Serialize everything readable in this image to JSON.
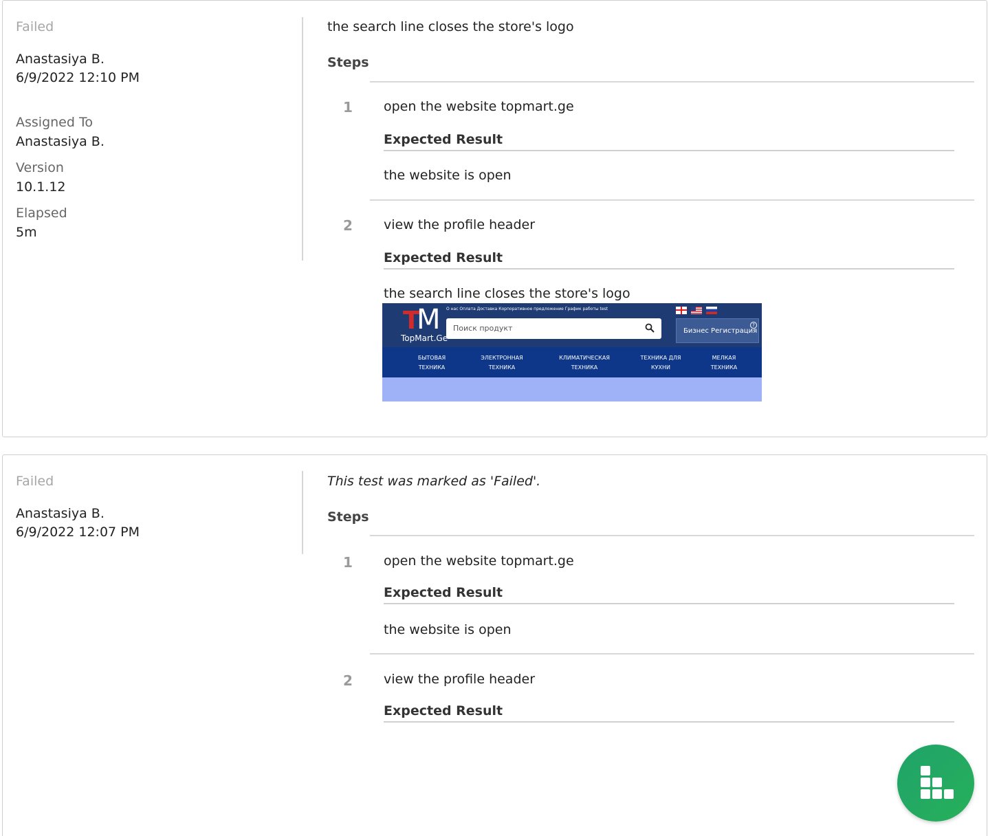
{
  "results": [
    {
      "status": "Failed",
      "author": "Anastasiya B.",
      "date": "6/9/2022 12:10 PM",
      "fields": [
        {
          "label": "Assigned To",
          "value": "Anastasiya B."
        },
        {
          "label": "Version",
          "value": "10.1.12"
        },
        {
          "label": "Elapsed",
          "value": "5m"
        }
      ],
      "comment": "the search line closes the store's logo",
      "steps_title": "Steps",
      "steps": [
        {
          "number": "1",
          "text": "open the website topmart.ge",
          "expected_title": "Expected Result",
          "expected_text": "the website is open"
        },
        {
          "number": "2",
          "text": "view the profile header",
          "expected_title": "Expected Result",
          "expected_text": "the search line closes the store's logo"
        }
      ]
    },
    {
      "status": "Failed",
      "author": "Anastasiya B.",
      "date": "6/9/2022 12:07 PM",
      "comment": "This test was marked as 'Failed'.",
      "steps_title": "Steps",
      "steps": [
        {
          "number": "1",
          "text": "open the website topmart.ge",
          "expected_title": "Expected Result",
          "expected_text": "the website is open"
        },
        {
          "number": "2",
          "text": "view the profile header",
          "expected_title": "Expected Result"
        }
      ]
    }
  ],
  "attachment": {
    "logo_t": "T",
    "logo_m": "M",
    "logo_name": "TopMart.Ge",
    "top_links": "О нас  Оплата  Доставка  Корпоративное предложение  График работы  test",
    "search_placeholder": "Поиск продукт",
    "business_button": "Бизнес Регистрация",
    "help_symbol": "?",
    "nav": [
      {
        "line1": "БЫТОВАЯ",
        "line2": "ТЕХНИКА"
      },
      {
        "line1": "ЭЛЕКТРОННАЯ",
        "line2": "ТЕХНИКА"
      },
      {
        "line1": "КЛИМАТИЧЕСКАЯ",
        "line2": "ТЕХНИКА"
      },
      {
        "line1": "ТЕХНИКА ДЛЯ",
        "line2": "КУХНИ"
      },
      {
        "line1": "МЕЛКАЯ",
        "line2": "ТЕХНИКА"
      }
    ],
    "colors": {
      "header": "#1e3b74",
      "nav": "#0f3789",
      "band": "#9fb2f7"
    }
  },
  "fab": {
    "icon": "blocks-icon",
    "color": "#1fa36a"
  }
}
